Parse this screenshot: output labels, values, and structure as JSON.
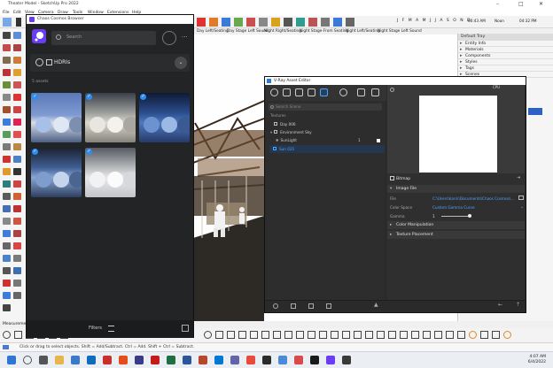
{
  "sketchup": {
    "title": "Theater Model - SketchUp Pro 2022",
    "menu": [
      "File",
      "Edit",
      "View",
      "Camera",
      "Draw",
      "Tools",
      "Window",
      "Extensions",
      "Help"
    ],
    "top_right_time": "00:43 AM",
    "top_right_noon": "Noon",
    "top_right_time2": "04:32 PM",
    "scene_tabs": [
      "Day Left/Seating",
      "Day Stage Left Sound",
      "Night Right/Seating",
      "Night Stage-From Seating",
      "Night Left/Seating",
      "Night Stage Left Sound"
    ],
    "tray": {
      "title": "Default Tray",
      "items": [
        "Entity Info",
        "Materials",
        "Components",
        "Styles",
        "Tags",
        "Scenes"
      ],
      "bottom_label": "Day Left/Seating"
    },
    "measurements_label": "Measurements",
    "status_text": "Click or drag to select objects. Shift = Add/Subtract. Ctrl = Add. Shift + Ctrl = Subtract."
  },
  "cosmos": {
    "title": "Chaos Cosmos Browser",
    "search_placeholder": "Search",
    "category": "HDRIs",
    "assets_count": "5 assets",
    "footer_label": "Filters"
  },
  "vray": {
    "title": "V-Ray Asset Editor",
    "search_placeholder": "Search Scene",
    "cpu_label": "CPU",
    "tree": {
      "section": "Textures",
      "items": [
        "Day 006",
        "Environment Sky",
        "SunLight",
        "Sun 021"
      ],
      "sunlight_value": "1"
    },
    "props": {
      "header": "Bitmap",
      "image_file_section": "Image File",
      "file_label": "File",
      "file_value": "C:\\Users\\karin\\Documents\\Chaos Cosmos\\...",
      "color_space_label": "Color Space",
      "color_space_value": "Custom Gamma Curve",
      "gamma_label": "Gamma",
      "gamma_value": "1",
      "color_manipulation": "Color Manipulation",
      "texture_placement": "Texture Placement"
    }
  },
  "taskbar": {
    "time": "4:07 AM",
    "date": "6/4/2022"
  }
}
